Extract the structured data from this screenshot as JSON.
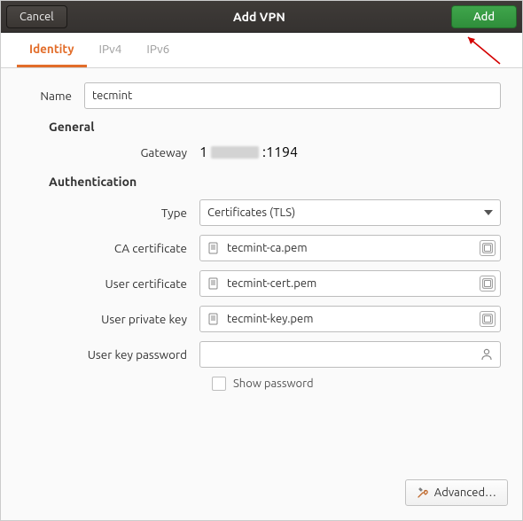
{
  "titlebar": {
    "cancel": "Cancel",
    "title": "Add VPN",
    "add": "Add"
  },
  "tabs": {
    "identity": "Identity",
    "ipv4": "IPv4",
    "ipv6": "IPv6"
  },
  "form": {
    "name_label": "Name",
    "name_value": "tecmint",
    "general_heading": "General",
    "gateway_label": "Gateway",
    "gateway_prefix": "1",
    "gateway_suffix": ":1194",
    "auth_heading": "Authentication",
    "type_label": "Type",
    "type_value": "Certificates (TLS)",
    "ca_label": "CA certificate",
    "ca_value": "tecmint-ca.pem",
    "usercert_label": "User certificate",
    "usercert_value": "tecmint-cert.pem",
    "userkey_label": "User private key",
    "userkey_value": "tecmint-key.pem",
    "pw_label": "User key password",
    "pw_value": "",
    "show_pw_label": "Show password"
  },
  "footer": {
    "advanced": "Advanced…"
  }
}
